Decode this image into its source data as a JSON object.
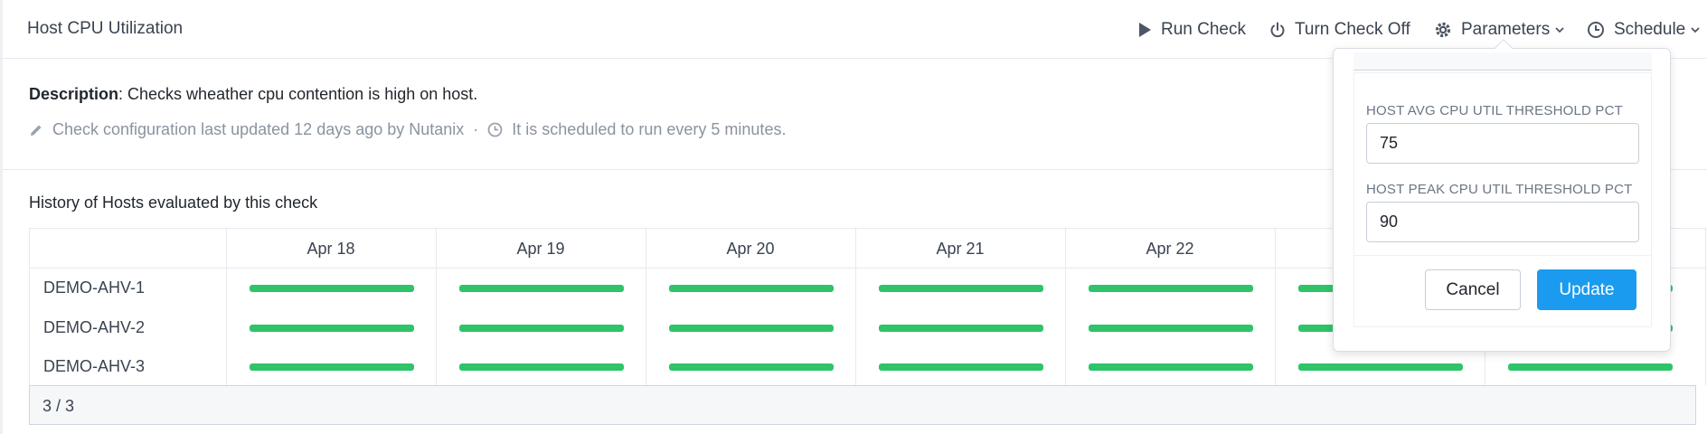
{
  "page": {
    "title": "Host CPU Utilization"
  },
  "toolbar": {
    "run_check": "Run Check",
    "turn_off": "Turn Check Off",
    "parameters": "Parameters",
    "schedule": "Schedule"
  },
  "description": {
    "label": "Description",
    "text": ": Checks wheather cpu contention is high on host.",
    "config_text": "Check configuration last updated 12 days ago by Nutanix",
    "separator": "·",
    "schedule_text": "It is scheduled to run every 5 minutes."
  },
  "history": {
    "title": "History of Hosts evaluated by this check",
    "dates": [
      "Apr 18",
      "Apr 19",
      "Apr 20",
      "Apr 21",
      "Apr 22"
    ],
    "hosts": [
      "DEMO-AHV-1",
      "DEMO-AHV-2",
      "DEMO-AHV-3"
    ],
    "status_color": "#2fc36a",
    "count": "3 / 3"
  },
  "popover": {
    "avg_label": "HOST AVG CPU UTIL THRESHOLD PCT",
    "avg_value": "75",
    "peak_label": "HOST PEAK CPU UTIL THRESHOLD PCT",
    "peak_value": "90",
    "cancel": "Cancel",
    "update": "Update",
    "primary_color": "#1b9bf0"
  }
}
